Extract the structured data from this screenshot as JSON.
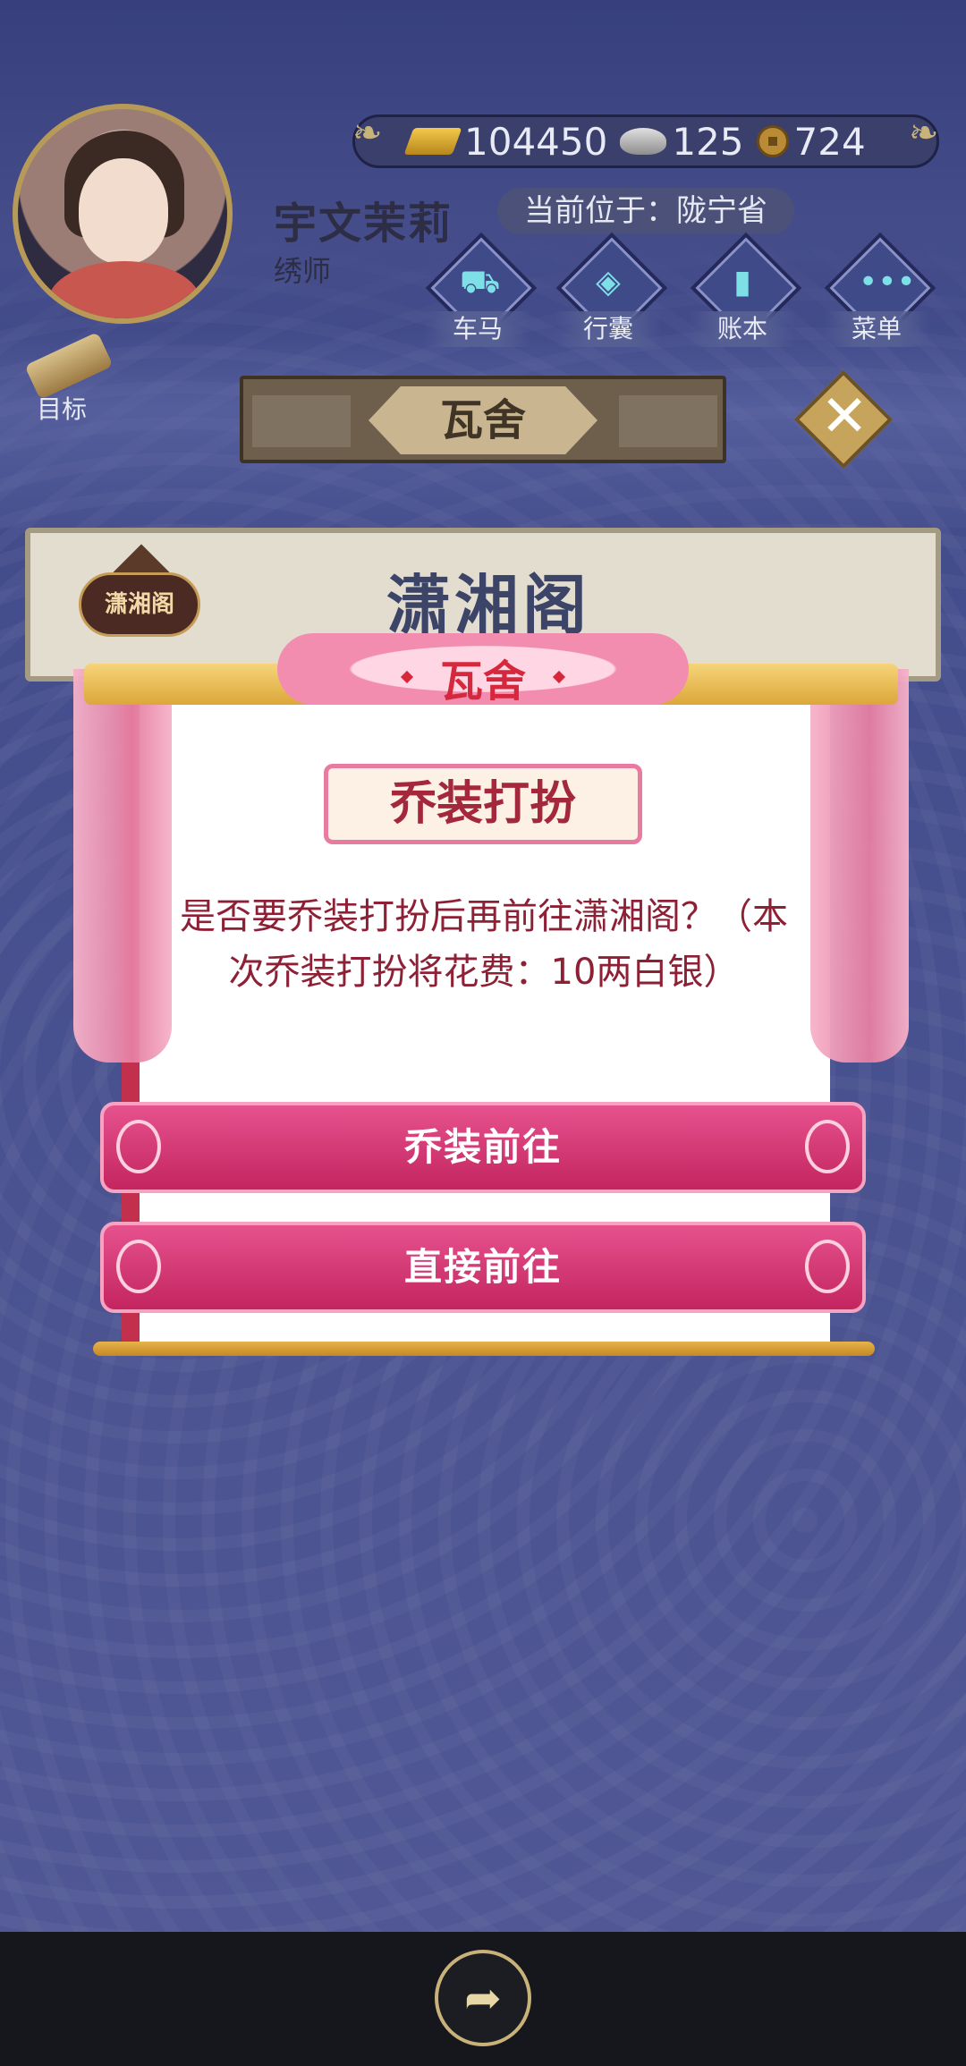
{
  "player": {
    "name": "宇文茉莉",
    "profession": "绣师",
    "location": "当前位于：陇宁省"
  },
  "currency": {
    "gold": "104450",
    "silver": "125",
    "coins": "724"
  },
  "nav": [
    {
      "label": "车马",
      "icon": "carriage-icon"
    },
    {
      "label": "行囊",
      "icon": "bag-icon"
    },
    {
      "label": "账本",
      "icon": "ledger-icon"
    },
    {
      "label": "菜单",
      "icon": "menu-dots-icon"
    }
  ],
  "goal": {
    "label": "目标"
  },
  "header": {
    "title": "瓦舍"
  },
  "banner": {
    "badge": "潇湘阁",
    "title": "潇湘阁"
  },
  "dialog": {
    "top_title": "瓦舍",
    "heading": "乔装打扮",
    "message": "是否要乔装打扮后再前往潇湘阁？（本次乔装打扮将花费：10两白银）",
    "primary_button": "乔装前往",
    "secondary_button": "直接前往"
  },
  "colors": {
    "background": "#3f4788",
    "dialog_accent": "#c2304e",
    "button": "#d83a78",
    "text_dark": "#8e2036"
  }
}
